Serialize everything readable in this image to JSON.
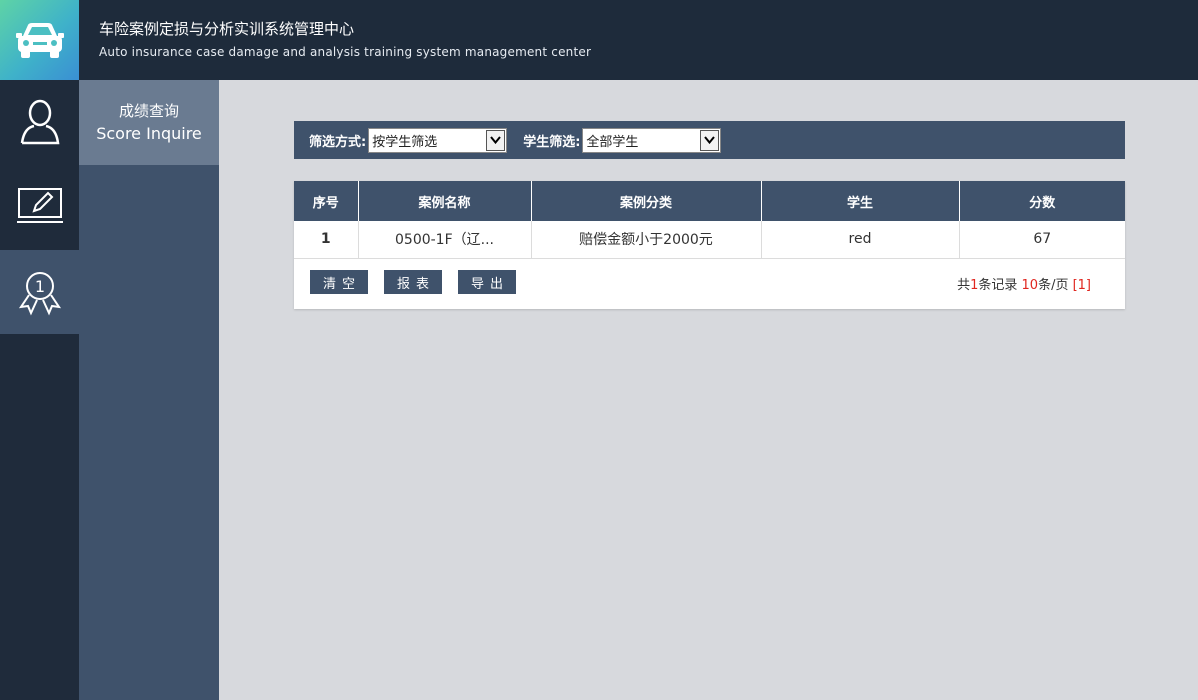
{
  "header": {
    "title_cn": "车险案例定损与分析实训系统管理中心",
    "title_en": "Auto insurance case damage and analysis training system management center"
  },
  "icons": {
    "logo": "car-icon",
    "user": "user-icon",
    "edit": "edit-icon",
    "award": "award-icon"
  },
  "sidebar": {
    "sub_item": {
      "cn": "成绩查询",
      "en": "Score Inquire"
    }
  },
  "filter": {
    "mode_label": "筛选方式:",
    "mode_value": "按学生筛选",
    "student_label": "学生筛选:",
    "student_value": "全部学生"
  },
  "table": {
    "headers": [
      "序号",
      "案例名称",
      "案例分类",
      "学生",
      "分数"
    ],
    "rows": [
      [
        "1",
        "0500-1F（辽...",
        "赔偿金额小于2000元",
        "red",
        "67"
      ]
    ]
  },
  "actions": {
    "clear": "清空",
    "report": "报表",
    "export": "导出"
  },
  "pager": {
    "prefix": "共",
    "total": "1",
    "mid": "条记录 ",
    "per_page": "10",
    "suffix": "条/页 ",
    "page": "[1]"
  },
  "colors": {
    "header_bg": "#1e2b3b",
    "panel": "#3f526b",
    "active_sub": "#6a7b91",
    "accent_red": "#e0261f"
  }
}
